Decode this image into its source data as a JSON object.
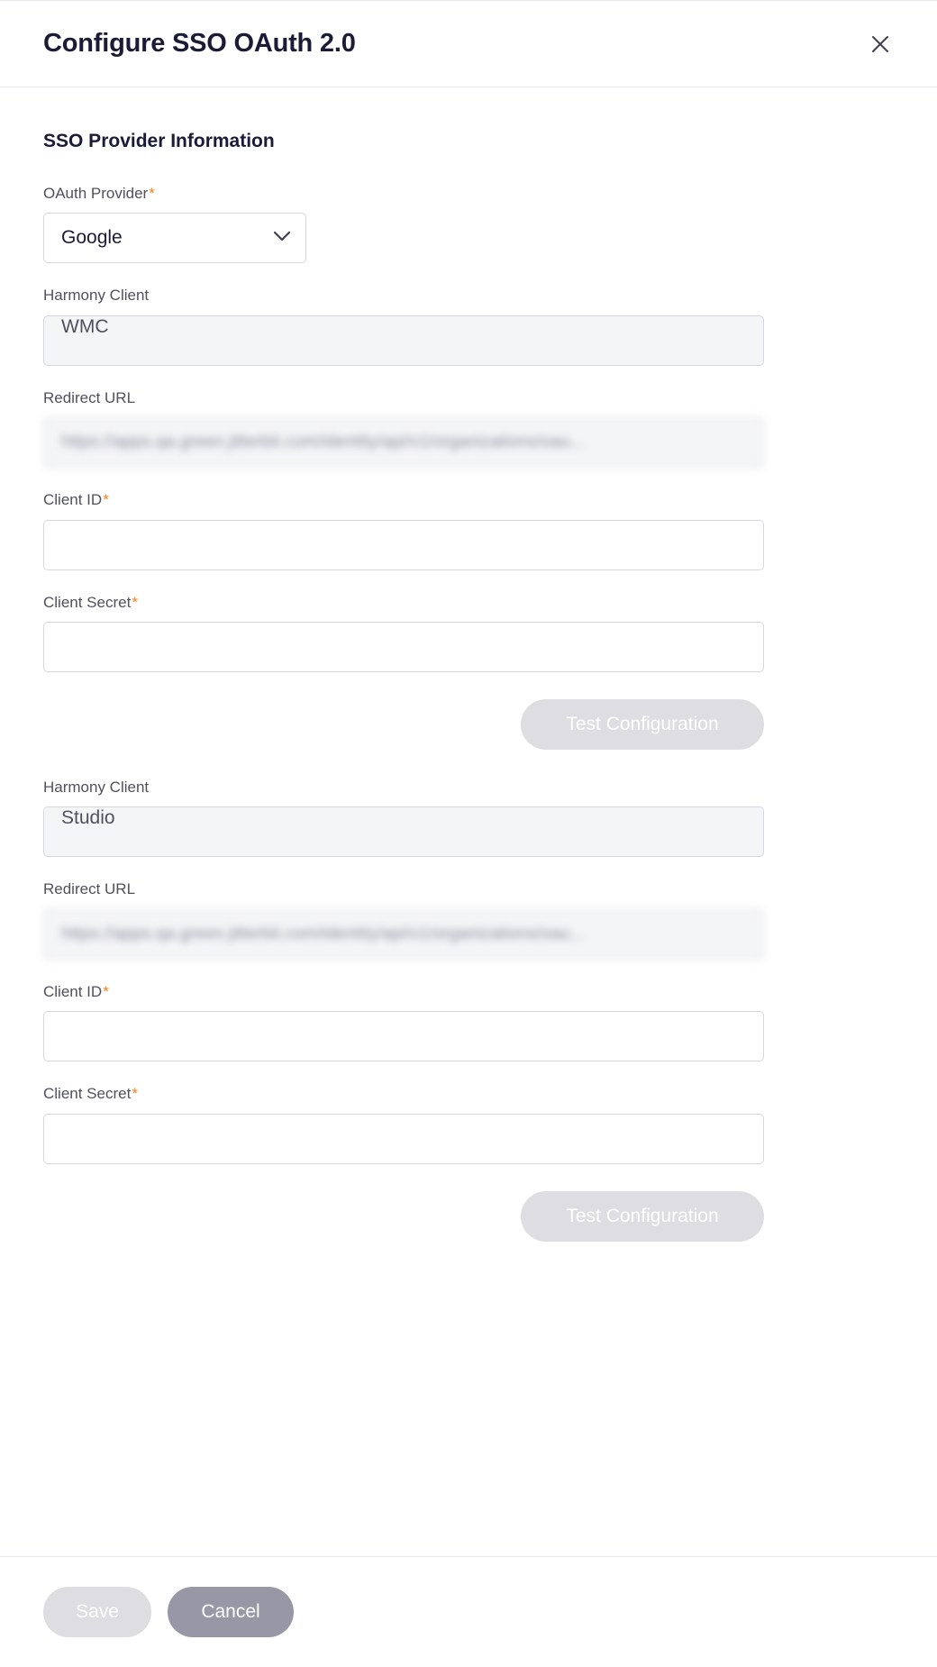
{
  "header": {
    "title": "Configure SSO OAuth 2.0",
    "close_icon": "close-icon"
  },
  "body": {
    "section_heading": "SSO Provider Information",
    "provider_field": {
      "label": "OAuth Provider",
      "required_marker": "*",
      "selected": "Google",
      "options": [
        "Google"
      ],
      "chevron_icon": "chevron-down-icon"
    },
    "client_blocks": [
      {
        "harmony_client_label": "Harmony Client",
        "harmony_client_value": "WMC",
        "redirect_url_label": "Redirect URL",
        "redirect_url_value": "https://apps.qa.green.jitterbit.com/identity/api/v1/organizations/oau...",
        "client_id_label": "Client ID",
        "client_id_required": "*",
        "client_id_value": "",
        "client_secret_label": "Client Secret",
        "client_secret_required": "*",
        "client_secret_value": "",
        "test_button_label": "Test Configuration"
      },
      {
        "harmony_client_label": "Harmony Client",
        "harmony_client_value": "Studio",
        "redirect_url_label": "Redirect URL",
        "redirect_url_value": "https://apps.qa.green.jitterbit.com/identity/api/v1/organizations/oau...",
        "client_id_label": "Client ID",
        "client_id_required": "*",
        "client_id_value": "",
        "client_secret_label": "Client Secret",
        "client_secret_required": "*",
        "client_secret_value": "",
        "test_button_label": "Test Configuration"
      }
    ]
  },
  "footer": {
    "save_label": "Save",
    "cancel_label": "Cancel"
  },
  "colors": {
    "accent_required": "#f58220",
    "title_text": "#1b1b38",
    "label_text": "#50505f",
    "border": "#d6d7e0",
    "disabled_bg": "#f4f5f7",
    "disabled_button": "#dedee2",
    "secondary_button": "#9797a6"
  }
}
